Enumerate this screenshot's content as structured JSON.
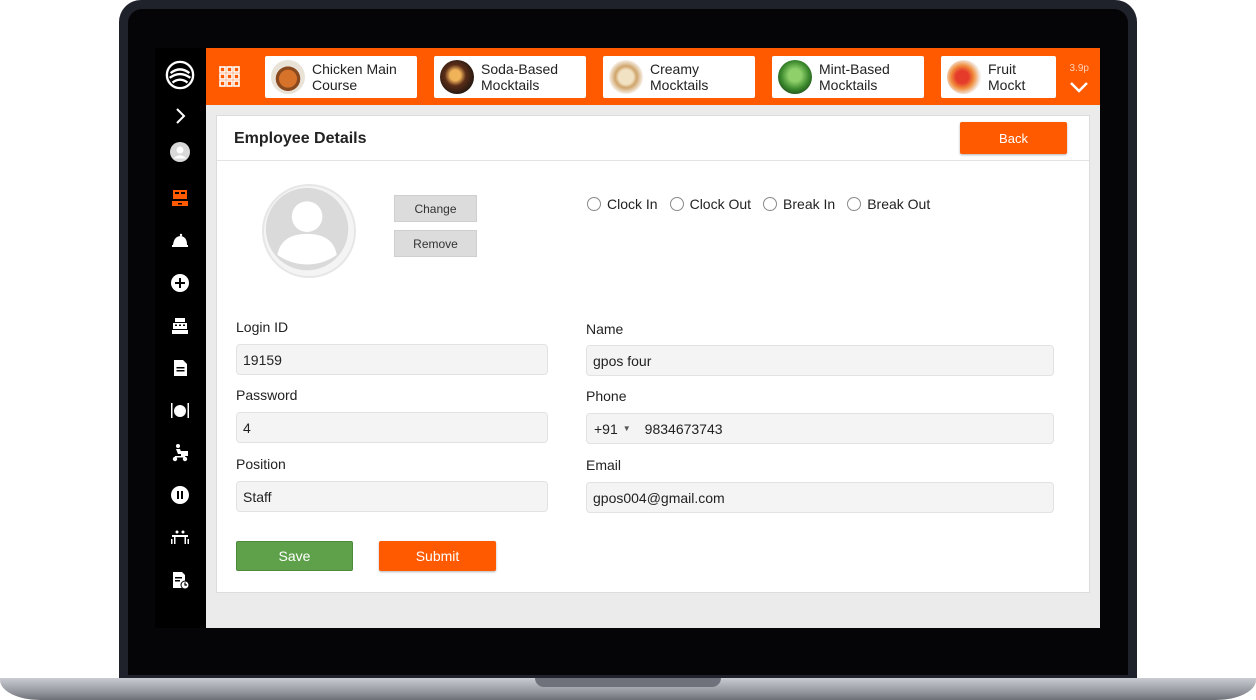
{
  "theme": {
    "accent": "#ff5a00",
    "save_green": "#5fa14a",
    "sidebar_bg": "#000000"
  },
  "sidebar": {
    "icons": [
      "logo-icon",
      "chevron-right-icon",
      "user-circle-icon",
      "pos-terminal-icon",
      "cloche-icon",
      "plus-circle-icon",
      "cash-register-icon",
      "document-icon",
      "dining-icon",
      "delivery-icon",
      "pause-icon",
      "table-icon",
      "report-icon"
    ]
  },
  "topbar": {
    "categories": [
      {
        "label": "Chicken Main\nCourse"
      },
      {
        "label": "Soda-Based\nMocktails"
      },
      {
        "label": "Creamy\nMocktails"
      },
      {
        "label": "Mint-Based\nMocktails"
      },
      {
        "label": "Fruit Mockt"
      }
    ],
    "version": "3.9p"
  },
  "panel": {
    "title": "Employee Details",
    "back_label": "Back",
    "change_label": "Change",
    "remove_label": "Remove"
  },
  "clock": {
    "options": [
      "Clock In",
      "Clock Out",
      "Break In",
      "Break Out"
    ]
  },
  "form": {
    "login_id_label": "Login ID",
    "login_id_value": "19159",
    "password_label": "Password",
    "password_value": "4",
    "position_label": "Position",
    "position_value": "Staff",
    "name_label": "Name",
    "name_value": "gpos four",
    "phone_label": "Phone",
    "phone_code": "+91",
    "phone_value": "9834673743",
    "email_label": "Email",
    "email_value": "gpos004@gmail.com"
  },
  "actions": {
    "save_label": "Save",
    "submit_label": "Submit"
  }
}
